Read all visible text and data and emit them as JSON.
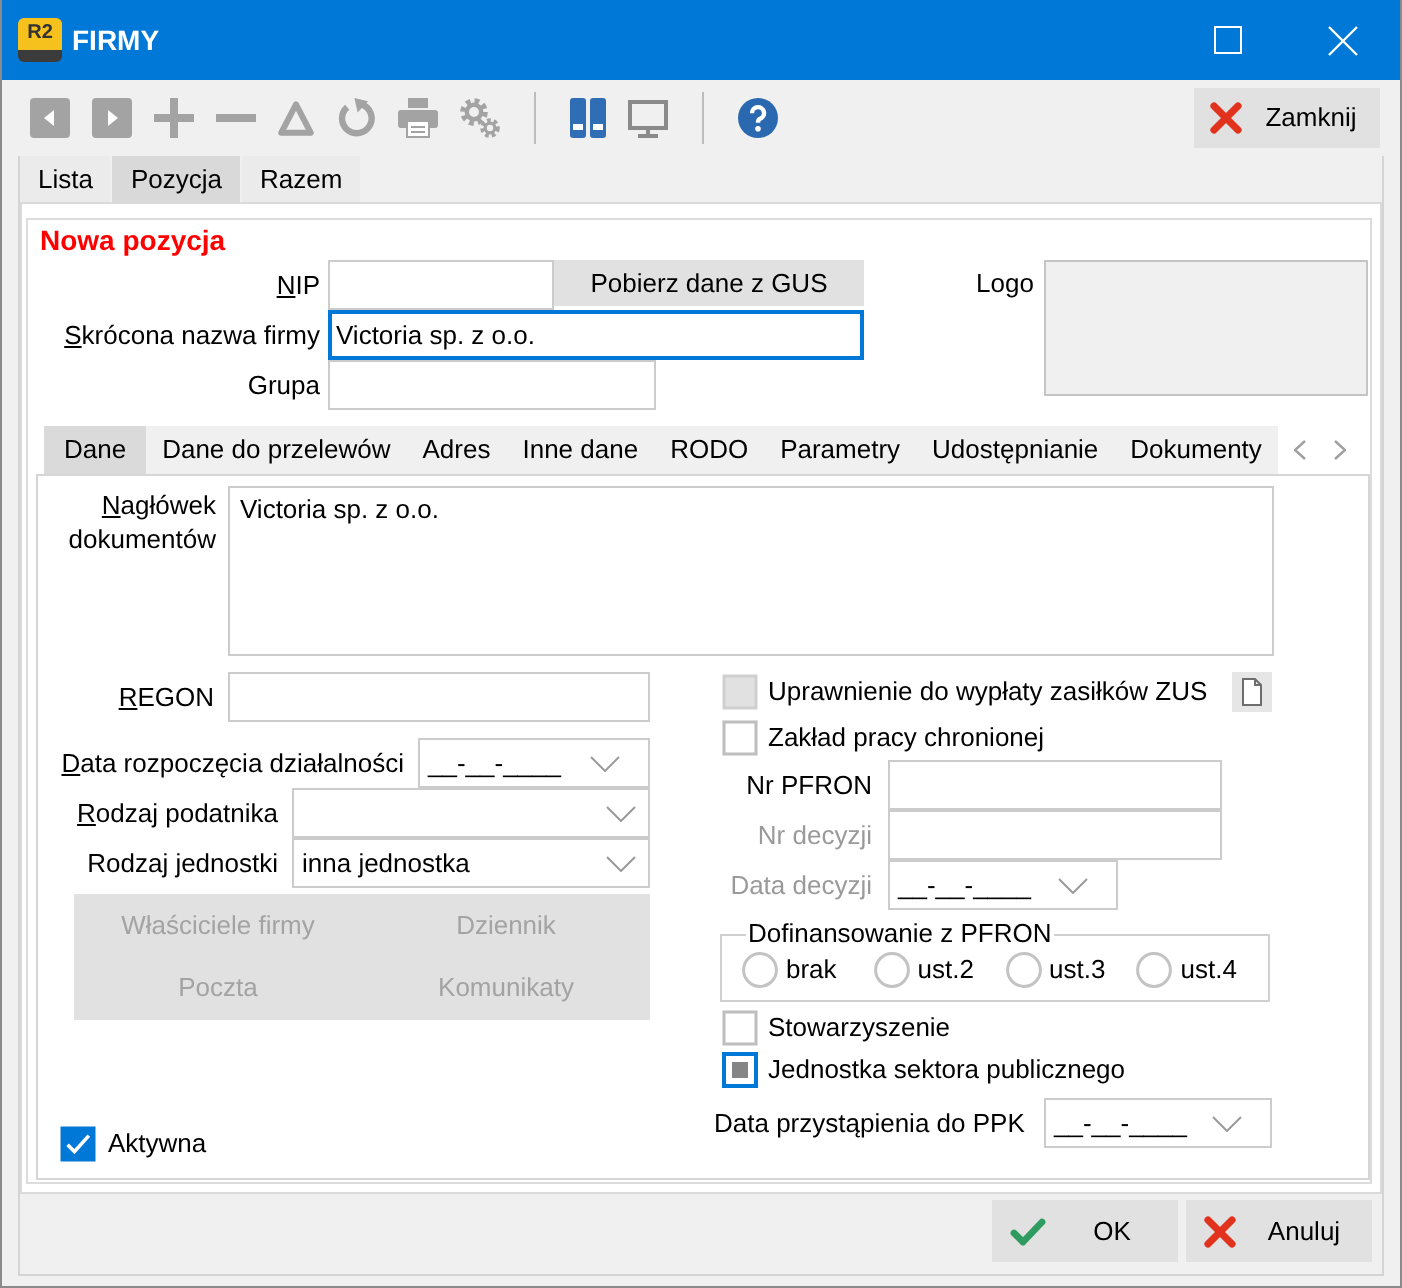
{
  "window": {
    "icon_text": "R2",
    "title": "FIRMY"
  },
  "toolbar": {
    "close_button": "Zamknij"
  },
  "tabs": [
    {
      "label": "Lista",
      "selected": false
    },
    {
      "label": "Pozycja",
      "selected": true
    },
    {
      "label": "Razem",
      "selected": false
    }
  ],
  "form": {
    "heading": "Nowa pozycja",
    "nip": {
      "label": "NIP",
      "mnemonic": true
    },
    "gus_button": "Pobierz dane z GUS",
    "short_name": {
      "label": "Skrócona nazwa firmy",
      "mnemonic": true,
      "value": "Victoria sp. z o.o.",
      "focused": true
    },
    "group": {
      "label": "Grupa"
    },
    "logo": {
      "label": "Logo"
    }
  },
  "detail_tabs": [
    {
      "label": "Dane",
      "selected": true
    },
    {
      "label": "Dane do przelewów",
      "selected": false
    },
    {
      "label": "Adres",
      "selected": false
    },
    {
      "label": "Inne dane",
      "selected": false
    },
    {
      "label": "RODO",
      "selected": false
    },
    {
      "label": "Parametry",
      "selected": false
    },
    {
      "label": "Udostępnianie",
      "selected": false
    },
    {
      "label": "Dokumenty",
      "selected": false
    }
  ],
  "dane": {
    "header": {
      "label": "Nagłówek dokumentów",
      "mnemonic": true,
      "value": "Victoria sp. z o.o."
    },
    "left_fields": [
      {
        "kind": "text",
        "label": "REGON",
        "mnemonic": true
      },
      {
        "kind": "date",
        "label": "Data rozpoczęcia działalności",
        "mnemonic": true,
        "value": "__-__-____"
      },
      {
        "kind": "select",
        "label": "Rodzaj podatnika",
        "mnemonic": true
      },
      {
        "kind": "select",
        "label": "Rodzaj jednostki",
        "mnemonic": false,
        "value": "inna jednostka"
      }
    ],
    "buttons": [
      {
        "label": "Właściciele firmy",
        "disabled": true
      },
      {
        "label": "Dziennik",
        "disabled": true
      },
      {
        "label": "Poczta",
        "disabled": true
      },
      {
        "label": "Komunikaty",
        "disabled": true
      }
    ],
    "active": {
      "label": "Aktywna",
      "checked": true
    },
    "top_checkboxes": [
      {
        "label": "Uprawnienie do wypłaty zasiłków ZUS",
        "checked": false,
        "indeterminate": false,
        "disabled": true,
        "focused": false,
        "document_button": true
      },
      {
        "label": "Zakład pracy chronionej",
        "checked": false,
        "indeterminate": false,
        "disabled": false,
        "focused": false,
        "document_button": false
      }
    ],
    "pfron_fields": [
      {
        "kind": "text",
        "label": "Nr PFRON",
        "disabled": false
      },
      {
        "kind": "text",
        "label": "Nr decyzji",
        "disabled": true
      },
      {
        "kind": "date",
        "label": "Data decyzji",
        "disabled": true,
        "value": "__-__-____"
      }
    ],
    "pfron_group": {
      "title": "Dofinansowanie z PFRON",
      "options": [
        {
          "label": "brak",
          "selected": false
        },
        {
          "label": "ust.2",
          "selected": false
        },
        {
          "label": "ust.3",
          "selected": false
        },
        {
          "label": "ust.4",
          "selected": false
        }
      ]
    },
    "bottom_checkboxes": [
      {
        "label": "Stowarzyszenie",
        "checked": false,
        "indeterminate": false,
        "disabled": false,
        "focused": false
      },
      {
        "label": "Jednostka sektora publicznego",
        "checked": false,
        "indeterminate": true,
        "disabled": false,
        "focused": true
      }
    ],
    "ppk_date": {
      "label": "Data przystąpienia do PPK",
      "value": "__-__-____"
    }
  },
  "dialog_buttons": [
    {
      "kind": "ok",
      "label": "OK"
    },
    {
      "kind": "cancel",
      "label": "Anuluj"
    }
  ]
}
